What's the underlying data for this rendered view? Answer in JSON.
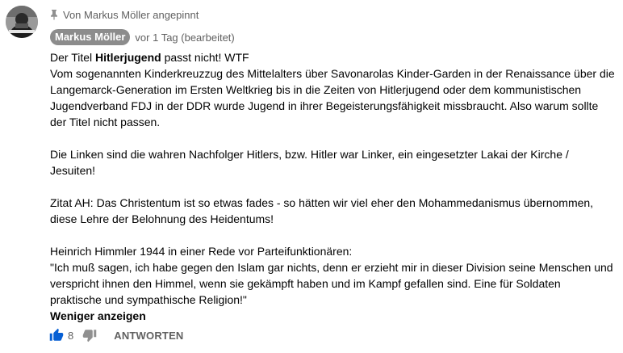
{
  "comment": {
    "pinned_text": "Von Markus Möller angepinnt",
    "author": "Markus Möller",
    "timestamp": "vor 1 Tag (bearbeitet)",
    "line1_prefix": "Der Titel ",
    "line1_bold": "Hitlerjugend",
    "line1_suffix": " passt nicht! WTF",
    "paragraph1": "Vom sogenannten Kinderkreuzzug des Mittelalters über Savonarolas Kinder-Garden in der Renaissance über die Langemarck-Generation im Ersten Weltkrieg bis in die Zeiten von Hitlerjugend oder dem kommunistischen Jugendverband FDJ in der DDR wurde Jugend in ihrer Begeisterungsfähigkeit missbraucht. Also warum sollte der Titel nicht passen.",
    "paragraph2": "Die Linken sind die wahren Nachfolger Hitlers, bzw. Hitler war Linker, ein eingesetzter Lakai der Kirche / Jesuiten!",
    "paragraph3": "Zitat AH: Das Christentum ist so etwas fades - so hätten wir viel eher den Mohammedanismus übernommen, diese Lehre der Belohnung des Heidentums!",
    "paragraph4_line1": "Heinrich Himmler 1944 in einer Rede vor Parteifunktionären:",
    "paragraph4_quote": "\"Ich muß sagen, ich habe gegen den Islam gar nichts, denn er erzieht mir in dieser Division seine Menschen  und verspricht ihnen den Himmel, wenn sie gekämpft haben und im Kampf gefallen sind. Eine für Soldaten praktische und sympathische Religion!\"",
    "show_less": "Weniger anzeigen"
  },
  "actions": {
    "like_count": "8",
    "reply_label": "ANTWORTEN"
  },
  "icons": {
    "pin": "pin-icon",
    "like": "thumbs-up-icon",
    "dislike": "thumbs-down-icon"
  },
  "colors": {
    "badge_bg": "#8c8c8c",
    "like_active": "#065fd4",
    "secondary_text": "#606060"
  }
}
